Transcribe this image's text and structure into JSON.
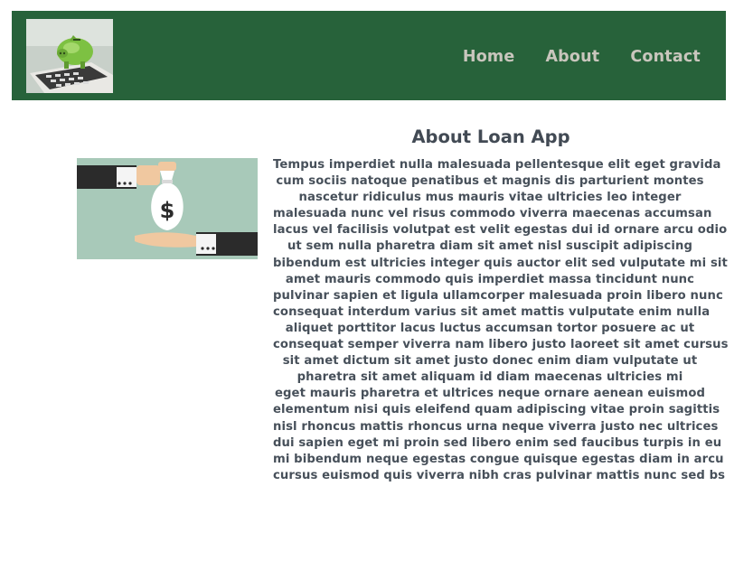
{
  "header": {
    "bg_color": "#27623a",
    "logo_icon": "piggy-bank-on-calculator-photo",
    "nav": [
      {
        "label": "Home"
      },
      {
        "label": "About"
      },
      {
        "label": "Contact"
      }
    ]
  },
  "main": {
    "image_icon": "money-bag-handover-illustration",
    "title": "About Loan App",
    "body_lines": [
      "Tempus imperdiet nulla malesuada pellentesque elit eget gravida",
      "cum sociis natoque penatibus et magnis dis parturient montes",
      "nascetur ridiculus mus mauris vitae ultricies leo integer",
      "malesuada nunc vel risus commodo viverra maecenas accumsan",
      "lacus vel facilisis volutpat est velit egestas dui id ornare arcu odio",
      "ut sem nulla pharetra diam sit amet nisl suscipit adipiscing",
      "bibendum est ultricies integer quis auctor elit sed vulputate mi sit",
      "amet mauris commodo quis imperdiet massa tincidunt nunc",
      "pulvinar sapien et ligula ullamcorper malesuada proin libero nunc",
      "consequat interdum varius sit amet mattis vulputate enim nulla",
      "aliquet porttitor lacus luctus accumsan tortor posuere ac ut",
      "consequat semper viverra nam libero justo laoreet sit amet cursus",
      "sit amet dictum sit amet justo donec enim diam vulputate ut",
      "pharetra sit amet aliquam id diam maecenas ultricies mi",
      "eget mauris pharetra et ultrices neque ornare aenean euismod",
      "elementum nisi quis eleifend quam adipiscing vitae proin sagittis",
      "nisl rhoncus mattis rhoncus urna neque viverra justo nec ultrices",
      "dui sapien eget mi proin sed libero enim sed faucibus turpis in eu",
      "mi bibendum neque egestas congue quisque egestas diam in arcu",
      "cursus euismod quis viverra nibh cras pulvinar mattis nunc sed bs"
    ]
  }
}
